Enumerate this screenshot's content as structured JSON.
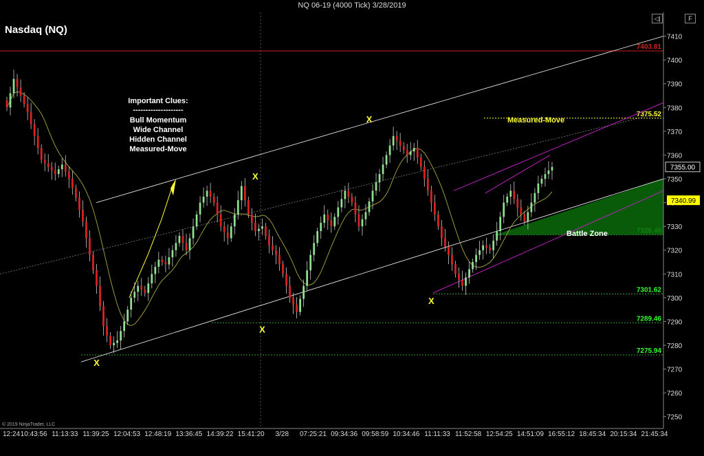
{
  "window": {
    "title": "NQ 06-19 (4000 Tick)  3/28/2019"
  },
  "chart_title": "Nasdaq (NQ)",
  "copyright": "© 2019 NinjaTrader, LLC",
  "controls": {
    "collapse": "◁|",
    "float": "F"
  },
  "notes": {
    "heading": "Important Clues:",
    "divider": "--------------------",
    "items": [
      "Bull Momentum",
      "Wide Channel",
      "Hidden Channel",
      "Measured-Move"
    ]
  },
  "annotations": {
    "measured_move": "Measured-Move",
    "battle_zone": "Battle Zone",
    "pivot_marker": "X"
  },
  "colors": {
    "up_candle": "#8fe08f",
    "down_candle": "#dd2222",
    "wick": "#cccccc",
    "moving_average": "#9a9a3a",
    "resistance_line": "#cc2222",
    "level_line": "#2fa52f",
    "channel": "#ffffff",
    "hidden_channel": "#c020c0",
    "battle_zone": "#0a6a0a",
    "pivot_label": "#ffff33",
    "grid": "#222222"
  },
  "chart_data": {
    "type": "candlestick",
    "symbol": "NQ 06-19",
    "ylim": [
      7245,
      7420
    ],
    "y_ticks": [
      7250,
      7260,
      7270,
      7280,
      7290,
      7300,
      7310,
      7320,
      7330,
      7340,
      7350,
      7360,
      7370,
      7380,
      7390,
      7400,
      7410
    ],
    "x_tick_labels": [
      "12:24",
      "10:43:56",
      "11:13:33",
      "11:39:25",
      "12:04:53",
      "12:48:19",
      "13:36:45",
      "14:39:22",
      "15:41:20",
      "3/28",
      "07:25:21",
      "09:34:36",
      "09:58:59",
      "10:34:46",
      "11:11:33",
      "11:52:58",
      "12:54:25",
      "14:51:09",
      "16:55:12",
      "18:45:34",
      "20:15:34",
      "21:45:34"
    ],
    "price_levels": [
      {
        "value": 7403.81,
        "label": "7403.81",
        "color": "#cc2222"
      },
      {
        "value": 7375.52,
        "label": "7375.52",
        "color": "#ffff33"
      },
      {
        "value": 7326.46,
        "label": "7326.46",
        "color": "#33ff33"
      },
      {
        "value": 7301.62,
        "label": "7301.62",
        "color": "#33ff33"
      },
      {
        "value": 7289.46,
        "label": "7289.46",
        "color": "#33ff33"
      },
      {
        "value": 7275.94,
        "label": "7275.94",
        "color": "#33ff33"
      }
    ],
    "last_price": {
      "value": 7355.0,
      "label": "7355.00"
    },
    "ma_price": {
      "value": 7340.99,
      "label": "7340.99"
    },
    "pivots": [
      {
        "bar": 13,
        "price": 7276,
        "type": "low"
      },
      {
        "bar": 36,
        "price": 7348,
        "type": "high"
      },
      {
        "bar": 37,
        "price": 7290,
        "type": "low"
      },
      {
        "bar": 53,
        "price": 7372,
        "type": "high"
      },
      {
        "bar": 62,
        "price": 7302,
        "type": "low"
      }
    ],
    "anchors": [
      [
        7380,
        7392,
        7385,
        7378,
        7368,
        7358,
        7355,
        7352,
        7356,
        7350,
        7342,
        7332,
        7318
      ],
      [
        7305,
        7288,
        7280,
        7282,
        7290,
        7300,
        7305,
        7302,
        7310,
        7316,
        7314,
        7320,
        7326,
        7320,
        7330,
        7340,
        7345,
        7340
      ],
      [
        7330,
        7325,
        7335,
        7347,
        7335,
        7328,
        7330,
        7322,
        7318,
        7310
      ],
      [
        7300,
        7294,
        7305,
        7318,
        7328,
        7335,
        7330,
        7338,
        7345,
        7340,
        7330,
        7336,
        7345,
        7352,
        7360,
        7368,
        7364,
        7360
      ],
      [
        7363,
        7355,
        7345,
        7335,
        7325,
        7318,
        7310,
        7305,
        7312,
        7318,
        7322,
        7320,
        7328,
        7340,
        7345,
        7338,
        7332,
        7340,
        7348,
        7352,
        7355
      ]
    ]
  }
}
